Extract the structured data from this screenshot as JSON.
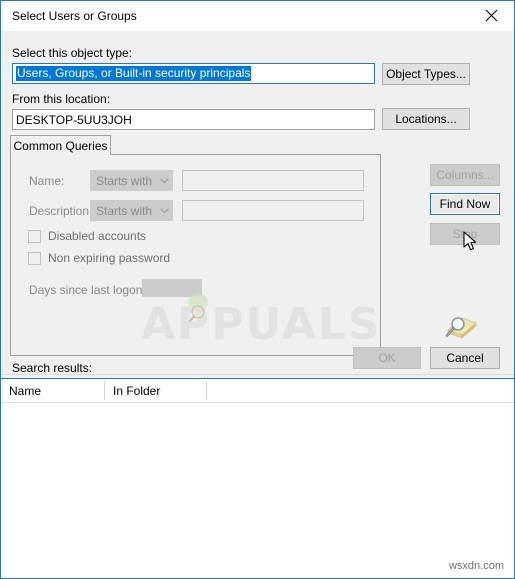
{
  "window": {
    "title": "Select Users or Groups",
    "close_icon": "close-icon"
  },
  "object_type": {
    "label": "Select this object type:",
    "value": "Users, Groups, or Built-in security principals",
    "button_label": "Object Types..."
  },
  "location": {
    "label": "From this location:",
    "value": "DESKTOP-5UU3JOH",
    "button_label": "Locations..."
  },
  "tabs": [
    {
      "label": "Common Queries",
      "selected": true
    }
  ],
  "query": {
    "name": {
      "label": "Name:",
      "operator": "Starts with",
      "value": "",
      "placeholder": ""
    },
    "description": {
      "label": "Description:",
      "operator": "Starts with",
      "value": "",
      "placeholder": ""
    },
    "disabled_accounts": {
      "label": "Disabled accounts",
      "checked": false
    },
    "non_expiring_password": {
      "label": "Non expiring password",
      "checked": false
    },
    "days_since_last_logon": {
      "label": "Days since last logon:",
      "value": ""
    }
  },
  "side_buttons": {
    "columns": {
      "label": "Columns...",
      "enabled": false
    },
    "find_now": {
      "label": "Find Now",
      "enabled": true,
      "focused": true
    },
    "stop": {
      "label": "Stop",
      "enabled": false
    },
    "icon": "magnifier-key-icon"
  },
  "footer": {
    "ok_label": "OK",
    "ok_enabled": false,
    "cancel_label": "Cancel",
    "cancel_enabled": true
  },
  "search_results": {
    "label": "Search results:",
    "columns": [
      "Name",
      "In Folder"
    ],
    "rows": []
  },
  "watermarks": {
    "center": "APPUALS",
    "corner": "wsxdn.com"
  },
  "colors": {
    "accent": "#2a7ab0",
    "selection": "#0078d7",
    "dialog_bg": "#f0f0f0",
    "disabled_text": "#8a8a8a"
  }
}
